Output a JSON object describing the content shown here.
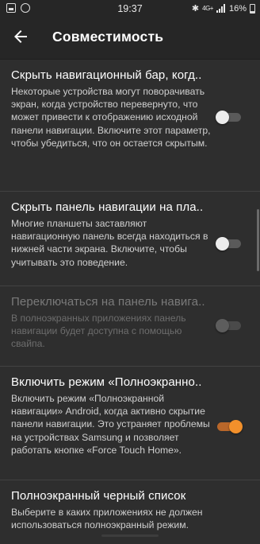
{
  "status": {
    "time": "19:37",
    "network": "4G+",
    "battery": "16%"
  },
  "appbar": {
    "title": "Совместимость"
  },
  "items": [
    {
      "title": "Скрыть навигационный бар, когд..",
      "desc": "Некоторые устройства могут поворачивать экран, когда устройство перевернуто, что может привести к отображению исходной панели навигации. Включите этот параметр, чтобы убедиться, что он остается скрытым.",
      "toggle": "off"
    },
    {
      "title": "Скрыть панель навигации на пла..",
      "desc": "Многие планшеты заставляют навигационную панель всегда находиться в нижней части экрана. Включите, чтобы учитывать это поведение.",
      "toggle": "off"
    },
    {
      "title": "Переключаться на панель навига..",
      "desc": "В полноэкранных приложениях панель навигации будет доступна с помощью свайпа.",
      "toggle": "disabled"
    },
    {
      "title": "Включить режим «Полноэкранно..",
      "desc": "Включить режим «Полноэкранной навигации» Android, когда активно скрытие панели навигации. Это устраняет проблемы на устройствах Samsung и позволяет работать кнопке «Force Touch Home».",
      "toggle": "on"
    },
    {
      "title": "Полноэкранный черный список",
      "desc": "Выберите в каких приложениях не должен использоваться полноэкранный режим."
    }
  ],
  "colors": {
    "accent": "#f2902b",
    "background": "#2e2e2e"
  }
}
